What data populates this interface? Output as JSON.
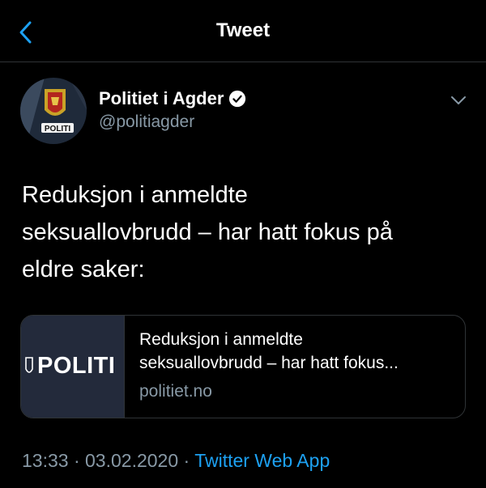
{
  "header": {
    "title": "Tweet"
  },
  "author": {
    "display_name": "Politiet i Agder",
    "handle": "@politiagder",
    "avatar_text": "POLITI"
  },
  "tweet": {
    "text_lines": [
      "Reduksjon i anmeldte",
      "seksuallovbrudd – har hatt fokus på",
      "eldre saker:"
    ]
  },
  "link_card": {
    "thumbnail_text": "POLITI",
    "title_lines": [
      "Reduksjon i anmeldte",
      "seksuallovbrudd – har hatt fokus..."
    ],
    "domain": "politiet.no"
  },
  "meta": {
    "time": "13:33",
    "separator": "·",
    "date": "03.02.2020",
    "source": "Twitter Web App"
  },
  "colors": {
    "background": "#000000",
    "accent": "#1da1f2",
    "secondary_text": "#8899a6",
    "divider": "#2f3336",
    "card_thumbnail": "#232a3b"
  },
  "icons": {
    "back": "chevron-left-icon",
    "verified": "verified-badge-icon",
    "more": "chevron-down-icon"
  }
}
